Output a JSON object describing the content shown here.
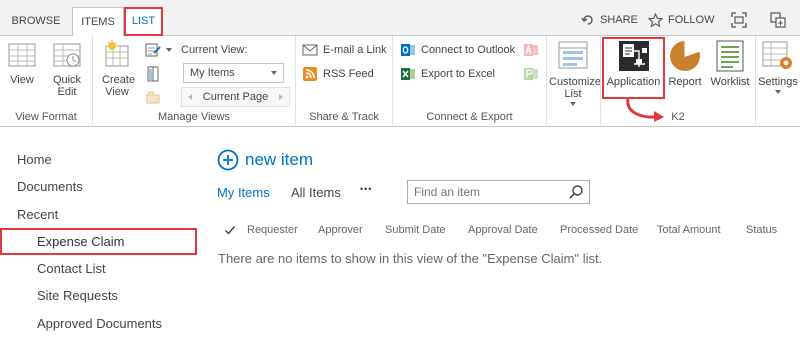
{
  "tabs": {
    "browse": "BROWSE",
    "items": "ITEMS",
    "list": "LIST"
  },
  "top_actions": {
    "share": "SHARE",
    "follow": "FOLLOW"
  },
  "ribbon": {
    "view_format": {
      "group_label": "View Format",
      "view": "View",
      "quick_edit": "Quick Edit"
    },
    "manage_views": {
      "group_label": "Manage Views",
      "create_view": "Create View",
      "current_view_label": "Current View:",
      "current_view_value": "My Items",
      "current_page": "Current Page"
    },
    "share_track": {
      "group_label": "Share & Track",
      "email_link": "E-mail a Link",
      "rss_feed": "RSS Feed"
    },
    "connect_export": {
      "group_label": "Connect & Export",
      "connect_outlook": "Connect to Outlook",
      "export_excel": "Export to Excel"
    },
    "customize": {
      "customize_list": "Customize List"
    },
    "k2": {
      "group_label": "K2",
      "application": "Application",
      "report": "Report",
      "worklist": "Worklist"
    },
    "settings": {
      "settings": "Settings"
    }
  },
  "nav": {
    "items": [
      "Home",
      "Documents",
      "Recent",
      "Expense Claim",
      "Contact List",
      "Site Requests",
      "Approved Documents"
    ]
  },
  "main": {
    "new_item": "new item",
    "views": [
      "My Items",
      "All Items"
    ],
    "more": "•••",
    "search_placeholder": "Find an item",
    "columns": [
      "Requester",
      "Approver",
      "Submit Date",
      "Approval Date",
      "Processed Date",
      "Total Amount",
      "Status"
    ],
    "empty_message": "There are no items to show in this view of the \"Expense Claim\" list."
  },
  "colors": {
    "accent": "#0072c6",
    "highlight": "#e03a3e"
  }
}
